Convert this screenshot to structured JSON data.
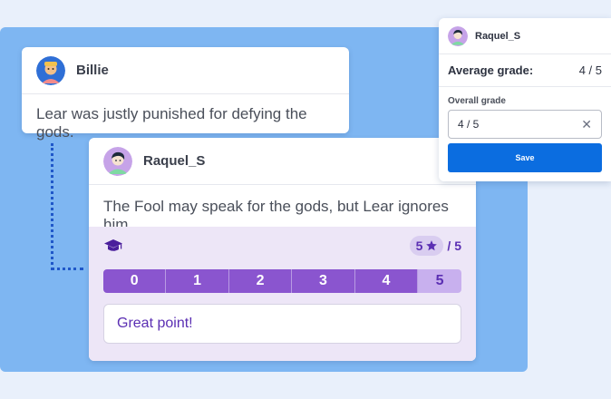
{
  "comments": [
    {
      "author": "Billie",
      "text": "Lear was justly punished for defying the gods."
    },
    {
      "author": "Raquel_S",
      "text": "The Fool may speak for the gods, but Lear ignores him."
    }
  ],
  "grading": {
    "score": "5",
    "max": "/ 5",
    "scale": [
      "0",
      "1",
      "2",
      "3",
      "4",
      "5"
    ],
    "selected_index": 5,
    "feedback": "Great point!"
  },
  "panel": {
    "user": "Raquel_S",
    "average_label": "Average grade:",
    "average_value": "4 / 5",
    "overall_label": "Overall grade",
    "overall_value": "4 / 5",
    "save_label": "Save"
  },
  "colors": {
    "accent_purple": "#8a55cf",
    "save_blue": "#0b6de0",
    "stage_blue": "#7eb6f2"
  },
  "icons": {
    "grade": "graduation-cap-icon",
    "rating": "star-icon",
    "clear": "close-icon"
  }
}
